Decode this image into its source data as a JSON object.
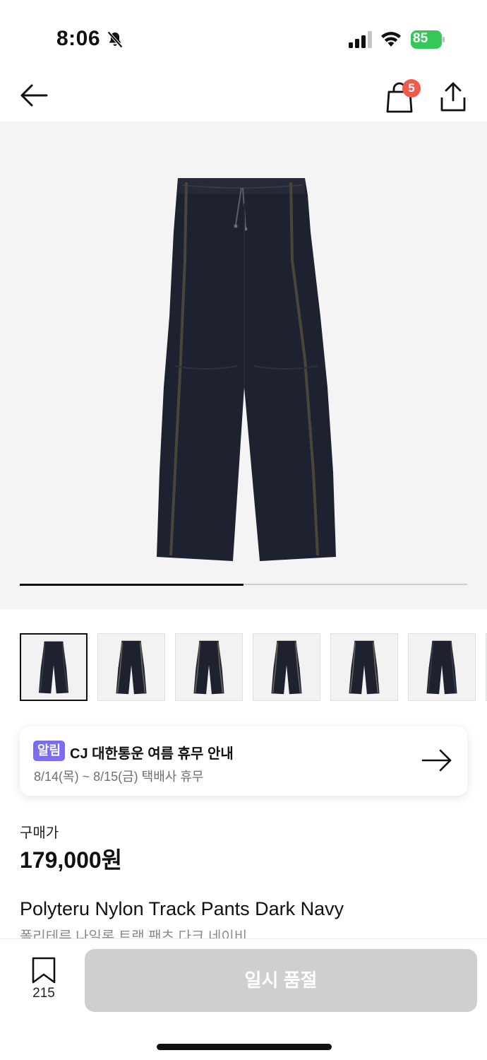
{
  "status_bar": {
    "time": "8:06",
    "battery": "85",
    "icons": [
      "bell-off-icon",
      "signal-icon",
      "wifi-icon",
      "battery-icon"
    ]
  },
  "nav": {
    "icons": [
      "back-arrow-icon",
      "shopping-bag-icon",
      "share-icon"
    ],
    "cart_count": "5"
  },
  "gallery": {
    "images_total": 2,
    "current_index": 1,
    "progress_fraction": 0.5,
    "thumbnail_count": 6,
    "selected_thumbnail": 0
  },
  "notice": {
    "badge": "알림",
    "title": "CJ 대한통운 여름 휴무 안내",
    "subtitle": "8/14(목) ~ 8/15(금) 택배사 휴무",
    "icon": "arrow-right-icon"
  },
  "price": {
    "label": "구매가",
    "value": "179,000원"
  },
  "product": {
    "name": "Polyteru Nylon Track Pants Dark Navy",
    "name_kr": "폴리테루 나일론 트랙 팬츠 다크 네이비"
  },
  "bottom_bar": {
    "wishlist_count": "215",
    "wishlist_icon": "bookmark-icon",
    "cta_label": "일시 품절"
  },
  "colors": {
    "badge_red": "#ef5a4b",
    "notice_purple": "#7b6df0",
    "battery_green": "#34c759",
    "cta_disabled": "#cfcfcf",
    "pants_navy": "#1e2230"
  }
}
